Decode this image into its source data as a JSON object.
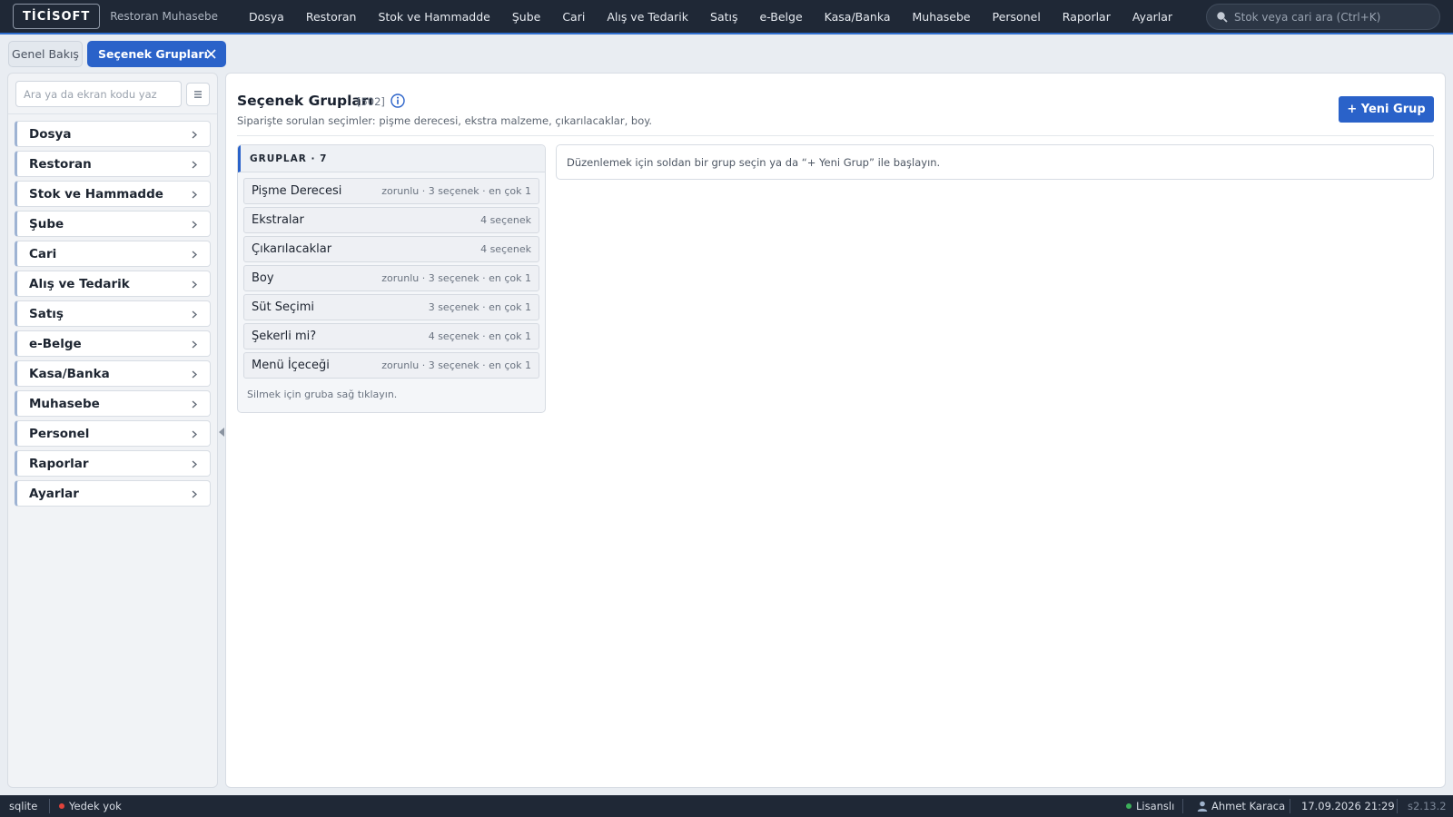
{
  "app": {
    "logo": "TİCİSOFT",
    "subtitle": "Restoran Muhasebe"
  },
  "menu": [
    "Dosya",
    "Restoran",
    "Stok ve Hammadde",
    "Şube",
    "Cari",
    "Alış ve Tedarik",
    "Satış",
    "e-Belge",
    "Kasa/Banka",
    "Muhasebe",
    "Personel",
    "Raporlar",
    "Ayarlar"
  ],
  "search": {
    "placeholder": "Stok veya cari ara (Ctrl+K)"
  },
  "tabs": {
    "home": "Genel Bakış",
    "active": "Seçenek Grupları"
  },
  "sidebar": {
    "search_placeholder": "Ara ya da ekran kodu yaz",
    "items": [
      "Dosya",
      "Restoran",
      "Stok ve Hammadde",
      "Şube",
      "Cari",
      "Alış ve Tedarik",
      "Satış",
      "e-Belge",
      "Kasa/Banka",
      "Muhasebe",
      "Personel",
      "Raporlar",
      "Ayarlar"
    ]
  },
  "page": {
    "title": "Seçenek Grupları",
    "code": "[502]",
    "description": "Siparişte sorulan seçimler: pişme derecesi, ekstra malzeme, çıkarılacaklar, boy.",
    "new_button": "+ Yeni Grup"
  },
  "groups": {
    "header": "GRUPLAR · 7",
    "items": [
      {
        "name": "Pişme Derecesi",
        "meta": "zorunlu · 3 seçenek · en çok 1"
      },
      {
        "name": "Ekstralar",
        "meta": "4 seçenek"
      },
      {
        "name": "Çıkarılacaklar",
        "meta": "4 seçenek"
      },
      {
        "name": "Boy",
        "meta": "zorunlu · 3 seçenek · en çok 1"
      },
      {
        "name": "Süt Seçimi",
        "meta": "3 seçenek · en çok 1"
      },
      {
        "name": "Şekerli mi?",
        "meta": "4 seçenek · en çok 1"
      },
      {
        "name": "Menü İçeceği",
        "meta": "zorunlu · 3 seçenek · en çok 1"
      }
    ],
    "hint": "Silmek için gruba sağ tıklayın."
  },
  "detail": {
    "empty_text": "Düzenlemek için soldan bir grup seçin ya da “+ Yeni Grup” ile başlayın."
  },
  "status": {
    "db": "sqlite",
    "backup": "Yedek yok",
    "license": "Lisanslı",
    "user": "Ahmet Karaca",
    "datetime": "17.09.2026 21:29",
    "version": "s2.13.2"
  },
  "colors": {
    "accent": "#2a62c9",
    "topbar": "#1f2836",
    "backup_dot": "#e0433b",
    "license_dot": "#3cb05a"
  },
  "icons": [
    "search-icon",
    "close-icon",
    "menu-icon",
    "chevron-right-icon",
    "info-icon",
    "collapse-handle-icon",
    "user-icon"
  ]
}
